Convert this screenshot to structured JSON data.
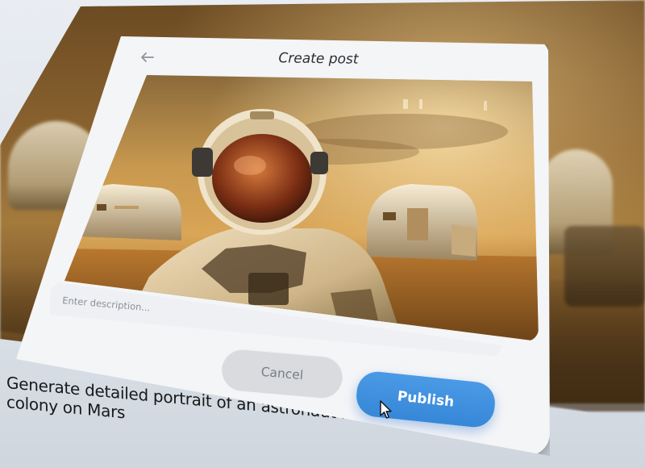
{
  "dialog": {
    "title": "Create post",
    "description": {
      "placeholder": "Enter description...",
      "value": ""
    },
    "buttons": {
      "cancel_label": "Cancel",
      "publish_label": "Publish"
    },
    "icons": {
      "back": "back-arrow-icon"
    }
  },
  "prompt": {
    "text": "Generate detailed portrait of an astronaut in a colony on Mars"
  },
  "colors": {
    "accent": "#3c8de0",
    "cancel_bg": "#d9dbdf",
    "dialog_bg": "#f4f5f7"
  }
}
